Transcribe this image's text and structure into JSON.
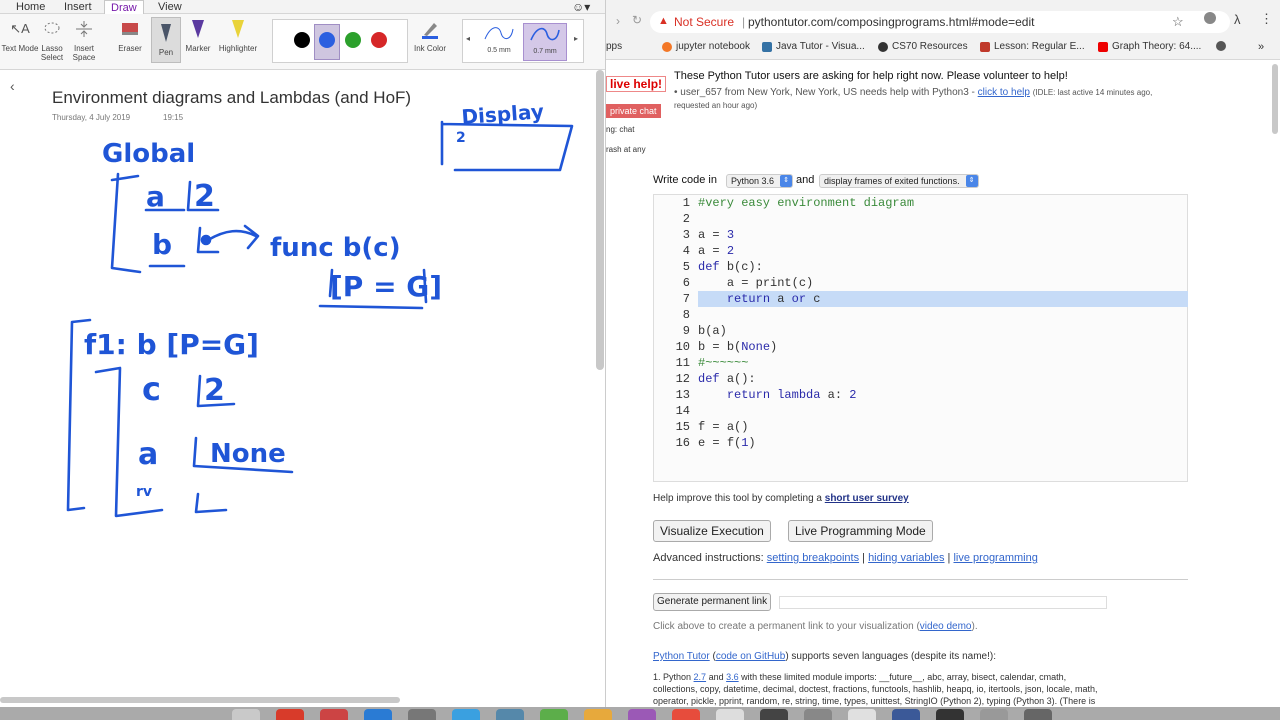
{
  "onenote": {
    "tabs": [
      "Home",
      "Insert",
      "Draw",
      "View"
    ],
    "tools": {
      "text_mode": "Text Mode",
      "lasso_select": "Lasso Select",
      "insert_space": "Insert Space",
      "eraser": "Eraser",
      "pen": "Pen",
      "marker": "Marker",
      "highlighter": "Highlighter",
      "ink_color": "Ink Color"
    },
    "colors": [
      "#000000",
      "#2b5fe0",
      "#2ca02c",
      "#d62728"
    ],
    "selected_color": "#2b5fe0",
    "sizes": [
      "0.5 mm",
      "0.7 mm"
    ],
    "page": {
      "title": "Environment diagrams and Lambdas (and HoF)",
      "date": "Thursday, 4 July 2019",
      "time": "19:15"
    },
    "ink_text": {
      "display": "Display",
      "two_top": "2",
      "global": "Global",
      "a": "a",
      "two": "2",
      "b": "b",
      "func": "func  b(c)",
      "parent": "[P = G]",
      "frame": "f1:  b [P=G]",
      "c": "c",
      "c_val": "2",
      "a2": "a",
      "none": "None",
      "rv": "rv"
    }
  },
  "browser": {
    "not_secure": "Not Secure",
    "url": "pythontutor.com/composingprograms.html#mode=edit",
    "bookmarks": [
      "pps",
      "jupyter notebook",
      "Java Tutor - Visua...",
      "CS70 Resources",
      "Lesson: Regular E...",
      "Graph Theory: 64...."
    ],
    "live_help": "live help!",
    "private_chat": "private chat",
    "side_text1": "ng: chat",
    "side_text2": "rash at any",
    "help_title": "These Python Tutor users are asking for help right now. Please volunteer to help!",
    "help_user": "user_657 from New York, New York, US needs help with Python3 -",
    "help_link": "click to help",
    "help_note": "(IDLE: last active 14 minutes ago,",
    "help_note2": "requested an hour ago)",
    "write_code_in": "Write code in",
    "python_version": "Python 3.6",
    "and": "and",
    "display_option": "display frames of exited functions.",
    "code_lines": [
      "#very easy environment diagram",
      "",
      "a = 3",
      "a = 2",
      "def b(c):",
      "    a = print(c)",
      "    return a or c",
      "",
      "b(a)",
      "b = b(None)",
      "#~~~~~~",
      "def a():",
      "    return lambda a: 2",
      "",
      "f = a()",
      "e = f(1)"
    ],
    "survey_text": "Help improve this tool by completing a",
    "survey_link": "short user survey",
    "visualize_btn": "Visualize Execution",
    "live_btn": "Live Programming Mode",
    "advanced": "Advanced instructions:",
    "adv_links": [
      "setting breakpoints",
      "hiding variables",
      "live programming"
    ],
    "permalink_btn": "Generate permanent link",
    "permalink_help": "Click above to create a permanent link to your visualization (",
    "video_demo": "video demo",
    "permalink_help_end": ").",
    "pt_link": "Python Tutor",
    "github_link": "code on GitHub",
    "pt_text": "supports seven languages (despite its name!):",
    "py_line1a": "1. Python",
    "py_v1": "2.7",
    "py_and": "and",
    "py_v2": "3.6",
    "py_line1b": "with these limited module imports: __future__, abc, array, bisect, calendar, cmath,",
    "py_line2": "collections, copy, datetime, decimal, doctest, fractions, functools, hashlib, heapq, io, itertools, json, locale, math,",
    "py_line3": "operator, pickle, pprint, random, re, string, time, types, unittest, StringIO (Python 2), typing (Python 3). (There is"
  },
  "dock_colors": [
    "#c9c9c9",
    "#d83b2a",
    "#c44",
    "#2a7bd4",
    "#777",
    "#3aa0e0",
    "#58a",
    "#5cae4a",
    "#e7a93c",
    "#9b59b6",
    "#e74c3c",
    "#ddd",
    "#444",
    "#888",
    "#e0e0e0",
    "#3b5998",
    "#333",
    "#999",
    "#666"
  ]
}
